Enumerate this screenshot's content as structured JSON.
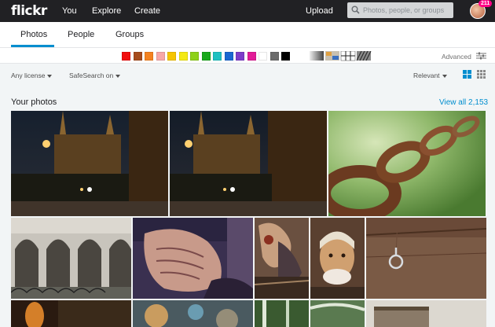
{
  "topbar": {
    "logo": "flickr",
    "nav": [
      "You",
      "Explore",
      "Create"
    ],
    "upload": "Upload",
    "search_placeholder": "Photos, people, or groups",
    "notification_count": "211"
  },
  "tabs": [
    "Photos",
    "People",
    "Groups"
  ],
  "active_tab": "Photos",
  "color_filters": [
    "#f10e0e",
    "#a64b1c",
    "#f58220",
    "#f7a7a7",
    "#f6c500",
    "#f4e914",
    "#8ed11a",
    "#19a81b",
    "#1fc1c1",
    "#1a67d1",
    "#7d3cc9",
    "#e21b97",
    "#ffffff",
    "#6c6c6c",
    "#000000"
  ],
  "filters": {
    "advanced": "Advanced",
    "license": "Any license",
    "safesearch": "SafeSearch on",
    "sort": "Relevant"
  },
  "section": {
    "title": "Your photos",
    "view_all": "View all 2,153"
  }
}
